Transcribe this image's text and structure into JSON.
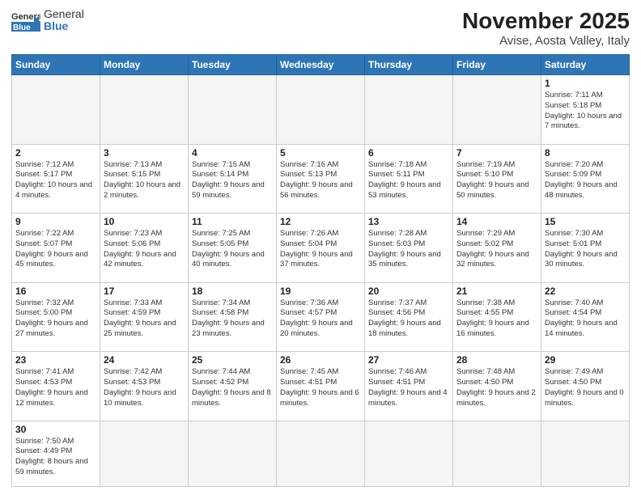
{
  "header": {
    "logo_general": "General",
    "logo_blue": "Blue",
    "title": "November 2025",
    "subtitle": "Avise, Aosta Valley, Italy"
  },
  "weekdays": [
    "Sunday",
    "Monday",
    "Tuesday",
    "Wednesday",
    "Thursday",
    "Friday",
    "Saturday"
  ],
  "weeks": [
    [
      {
        "day": "",
        "info": ""
      },
      {
        "day": "",
        "info": ""
      },
      {
        "day": "",
        "info": ""
      },
      {
        "day": "",
        "info": ""
      },
      {
        "day": "",
        "info": ""
      },
      {
        "day": "",
        "info": ""
      },
      {
        "day": "1",
        "info": "Sunrise: 7:11 AM\nSunset: 5:18 PM\nDaylight: 10 hours\nand 7 minutes."
      }
    ],
    [
      {
        "day": "2",
        "info": "Sunrise: 7:12 AM\nSunset: 5:17 PM\nDaylight: 10 hours\nand 4 minutes."
      },
      {
        "day": "3",
        "info": "Sunrise: 7:13 AM\nSunset: 5:15 PM\nDaylight: 10 hours\nand 2 minutes."
      },
      {
        "day": "4",
        "info": "Sunrise: 7:15 AM\nSunset: 5:14 PM\nDaylight: 9 hours\nand 59 minutes."
      },
      {
        "day": "5",
        "info": "Sunrise: 7:16 AM\nSunset: 5:13 PM\nDaylight: 9 hours\nand 56 minutes."
      },
      {
        "day": "6",
        "info": "Sunrise: 7:18 AM\nSunset: 5:11 PM\nDaylight: 9 hours\nand 53 minutes."
      },
      {
        "day": "7",
        "info": "Sunrise: 7:19 AM\nSunset: 5:10 PM\nDaylight: 9 hours\nand 50 minutes."
      },
      {
        "day": "8",
        "info": "Sunrise: 7:20 AM\nSunset: 5:09 PM\nDaylight: 9 hours\nand 48 minutes."
      }
    ],
    [
      {
        "day": "9",
        "info": "Sunrise: 7:22 AM\nSunset: 5:07 PM\nDaylight: 9 hours\nand 45 minutes."
      },
      {
        "day": "10",
        "info": "Sunrise: 7:23 AM\nSunset: 5:06 PM\nDaylight: 9 hours\nand 42 minutes."
      },
      {
        "day": "11",
        "info": "Sunrise: 7:25 AM\nSunset: 5:05 PM\nDaylight: 9 hours\nand 40 minutes."
      },
      {
        "day": "12",
        "info": "Sunrise: 7:26 AM\nSunset: 5:04 PM\nDaylight: 9 hours\nand 37 minutes."
      },
      {
        "day": "13",
        "info": "Sunrise: 7:28 AM\nSunset: 5:03 PM\nDaylight: 9 hours\nand 35 minutes."
      },
      {
        "day": "14",
        "info": "Sunrise: 7:29 AM\nSunset: 5:02 PM\nDaylight: 9 hours\nand 32 minutes."
      },
      {
        "day": "15",
        "info": "Sunrise: 7:30 AM\nSunset: 5:01 PM\nDaylight: 9 hours\nand 30 minutes."
      }
    ],
    [
      {
        "day": "16",
        "info": "Sunrise: 7:32 AM\nSunset: 5:00 PM\nDaylight: 9 hours\nand 27 minutes."
      },
      {
        "day": "17",
        "info": "Sunrise: 7:33 AM\nSunset: 4:59 PM\nDaylight: 9 hours\nand 25 minutes."
      },
      {
        "day": "18",
        "info": "Sunrise: 7:34 AM\nSunset: 4:58 PM\nDaylight: 9 hours\nand 23 minutes."
      },
      {
        "day": "19",
        "info": "Sunrise: 7:36 AM\nSunset: 4:57 PM\nDaylight: 9 hours\nand 20 minutes."
      },
      {
        "day": "20",
        "info": "Sunrise: 7:37 AM\nSunset: 4:56 PM\nDaylight: 9 hours\nand 18 minutes."
      },
      {
        "day": "21",
        "info": "Sunrise: 7:38 AM\nSunset: 4:55 PM\nDaylight: 9 hours\nand 16 minutes."
      },
      {
        "day": "22",
        "info": "Sunrise: 7:40 AM\nSunset: 4:54 PM\nDaylight: 9 hours\nand 14 minutes."
      }
    ],
    [
      {
        "day": "23",
        "info": "Sunrise: 7:41 AM\nSunset: 4:53 PM\nDaylight: 9 hours\nand 12 minutes."
      },
      {
        "day": "24",
        "info": "Sunrise: 7:42 AM\nSunset: 4:53 PM\nDaylight: 9 hours\nand 10 minutes."
      },
      {
        "day": "25",
        "info": "Sunrise: 7:44 AM\nSunset: 4:52 PM\nDaylight: 9 hours\nand 8 minutes."
      },
      {
        "day": "26",
        "info": "Sunrise: 7:45 AM\nSunset: 4:51 PM\nDaylight: 9 hours\nand 6 minutes."
      },
      {
        "day": "27",
        "info": "Sunrise: 7:46 AM\nSunset: 4:51 PM\nDaylight: 9 hours\nand 4 minutes."
      },
      {
        "day": "28",
        "info": "Sunrise: 7:48 AM\nSunset: 4:50 PM\nDaylight: 9 hours\nand 2 minutes."
      },
      {
        "day": "29",
        "info": "Sunrise: 7:49 AM\nSunset: 4:50 PM\nDaylight: 9 hours\nand 0 minutes."
      }
    ],
    [
      {
        "day": "30",
        "info": "Sunrise: 7:50 AM\nSunset: 4:49 PM\nDaylight: 8 hours\nand 59 minutes."
      },
      {
        "day": "",
        "info": ""
      },
      {
        "day": "",
        "info": ""
      },
      {
        "day": "",
        "info": ""
      },
      {
        "day": "",
        "info": ""
      },
      {
        "day": "",
        "info": ""
      },
      {
        "day": "",
        "info": ""
      }
    ]
  ]
}
